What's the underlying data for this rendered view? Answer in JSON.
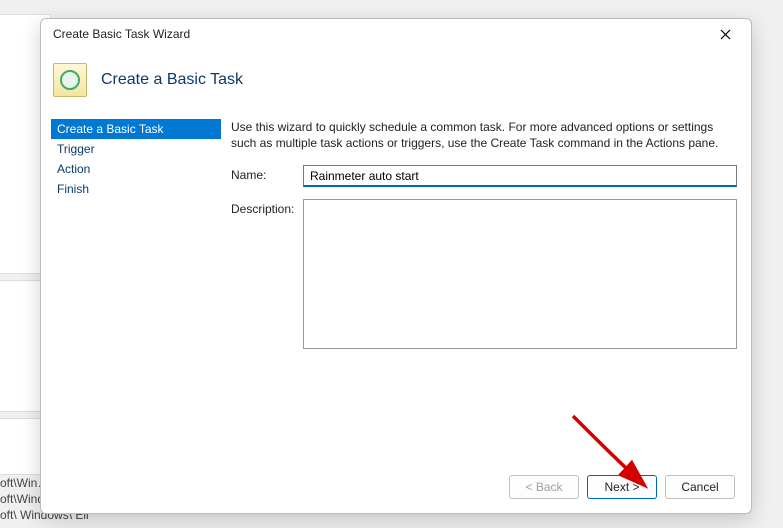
{
  "background": {
    "paths": [
      "oft\\Win…",
      "oft\\Windows\\U…",
      "oft\\ Windows\\ Eli"
    ]
  },
  "dialog": {
    "title": "Create Basic Task Wizard",
    "header": "Create a Basic Task",
    "steps": [
      "Create a Basic Task",
      "Trigger",
      "Action",
      "Finish"
    ],
    "selectedStep": 0,
    "instruction": "Use this wizard to quickly schedule a common task.  For more advanced options or settings such as multiple task actions or triggers, use the Create Task command in the Actions pane.",
    "nameLabel": "Name:",
    "nameValue": "Rainmeter auto start",
    "descriptionLabel": "Description:",
    "descriptionValue": "",
    "buttons": {
      "back": "< Back",
      "next": "Next >",
      "cancel": "Cancel"
    }
  }
}
